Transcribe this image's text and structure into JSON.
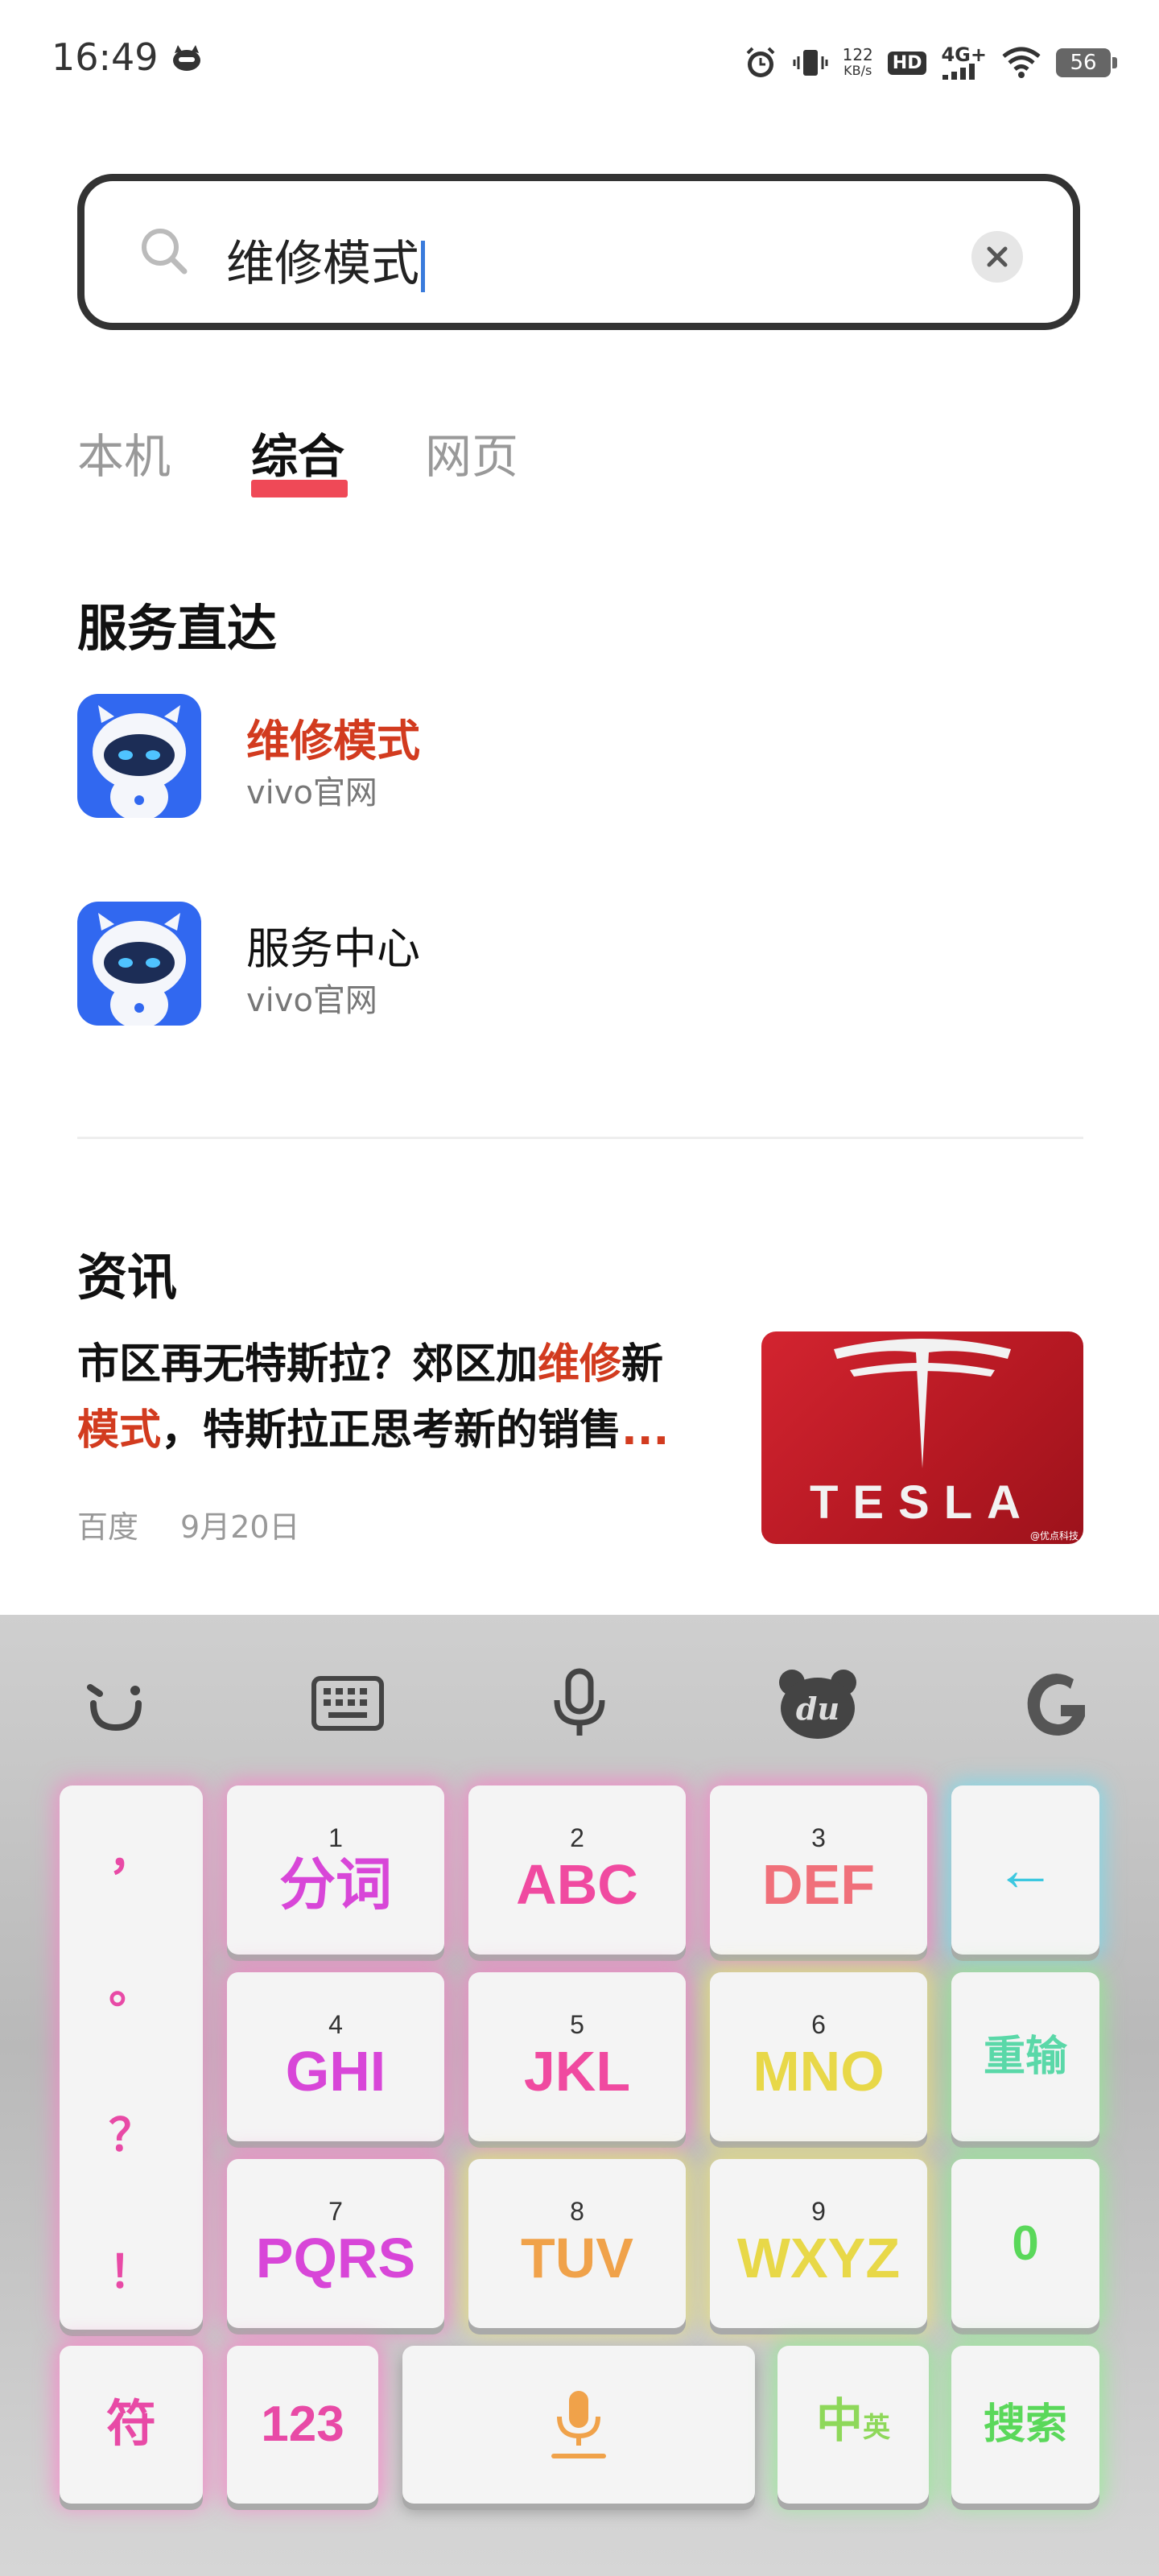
{
  "status_bar": {
    "time": "16:49",
    "speed_value": "122",
    "speed_unit": "KB/s",
    "hd": "HD",
    "network": "4G+",
    "battery": "56",
    "icons": [
      "alarm-icon",
      "vibrate-icon",
      "signal-icon",
      "wifi-icon"
    ]
  },
  "search": {
    "query": "维修模式"
  },
  "tabs": [
    {
      "label": "本机",
      "active": false
    },
    {
      "label": "综合",
      "active": true
    },
    {
      "label": "网页",
      "active": false
    }
  ],
  "services": {
    "title": "服务直达",
    "items": [
      {
        "name": "维修模式",
        "source": "vivo官网",
        "highlighted": true
      },
      {
        "name": "服务中心",
        "source": "vivo官网",
        "highlighted": false
      }
    ]
  },
  "news": {
    "title": "资讯",
    "headline_part1": "市区再无特斯拉？郊区加",
    "headline_hl1": "维修",
    "headline_part2": "新",
    "headline_hl2": "模式",
    "headline_part3": "，特斯拉正思考新的销售",
    "headline_ellipsis": "...",
    "source": "百度",
    "date": "9月20日",
    "thumb_text": "TESLA",
    "thumb_watermark": "@优点科技"
  },
  "keyboard": {
    "toolbar": [
      "emoji-icon",
      "keyboard-icon",
      "microphone-icon",
      "du-icon",
      "g-logo-icon"
    ],
    "du_text": "du",
    "punct": [
      "，",
      "。",
      "？",
      "！"
    ],
    "keys_row1": [
      {
        "num": "1",
        "label": "分词",
        "color": "#d846d8"
      },
      {
        "num": "2",
        "label": "ABC",
        "color": "#f04aa0"
      },
      {
        "num": "3",
        "label": "DEF",
        "color": "#f0707a"
      }
    ],
    "keys_row2": [
      {
        "num": "4",
        "label": "GHI",
        "color": "#d846d8"
      },
      {
        "num": "5",
        "label": "JKL",
        "color": "#f04aa0"
      },
      {
        "num": "6",
        "label": "MNO",
        "color": "#e8d848"
      }
    ],
    "keys_row3": [
      {
        "num": "7",
        "label": "PQRS",
        "color": "#d846d8"
      },
      {
        "num": "8",
        "label": "TUV",
        "color": "#f0a24a"
      },
      {
        "num": "9",
        "label": "WXYZ",
        "color": "#e8d848"
      }
    ],
    "backspace": "←",
    "reenter": "重输",
    "zero": "0",
    "symbol": "符",
    "num123": "123",
    "lang_zh": "中",
    "lang_en": "英",
    "search_key": "搜索",
    "colors": {
      "pink": "#e84aa6",
      "cyan": "#3cc8e0",
      "green": "#5ad85a",
      "orange": "#f0a24a"
    }
  }
}
